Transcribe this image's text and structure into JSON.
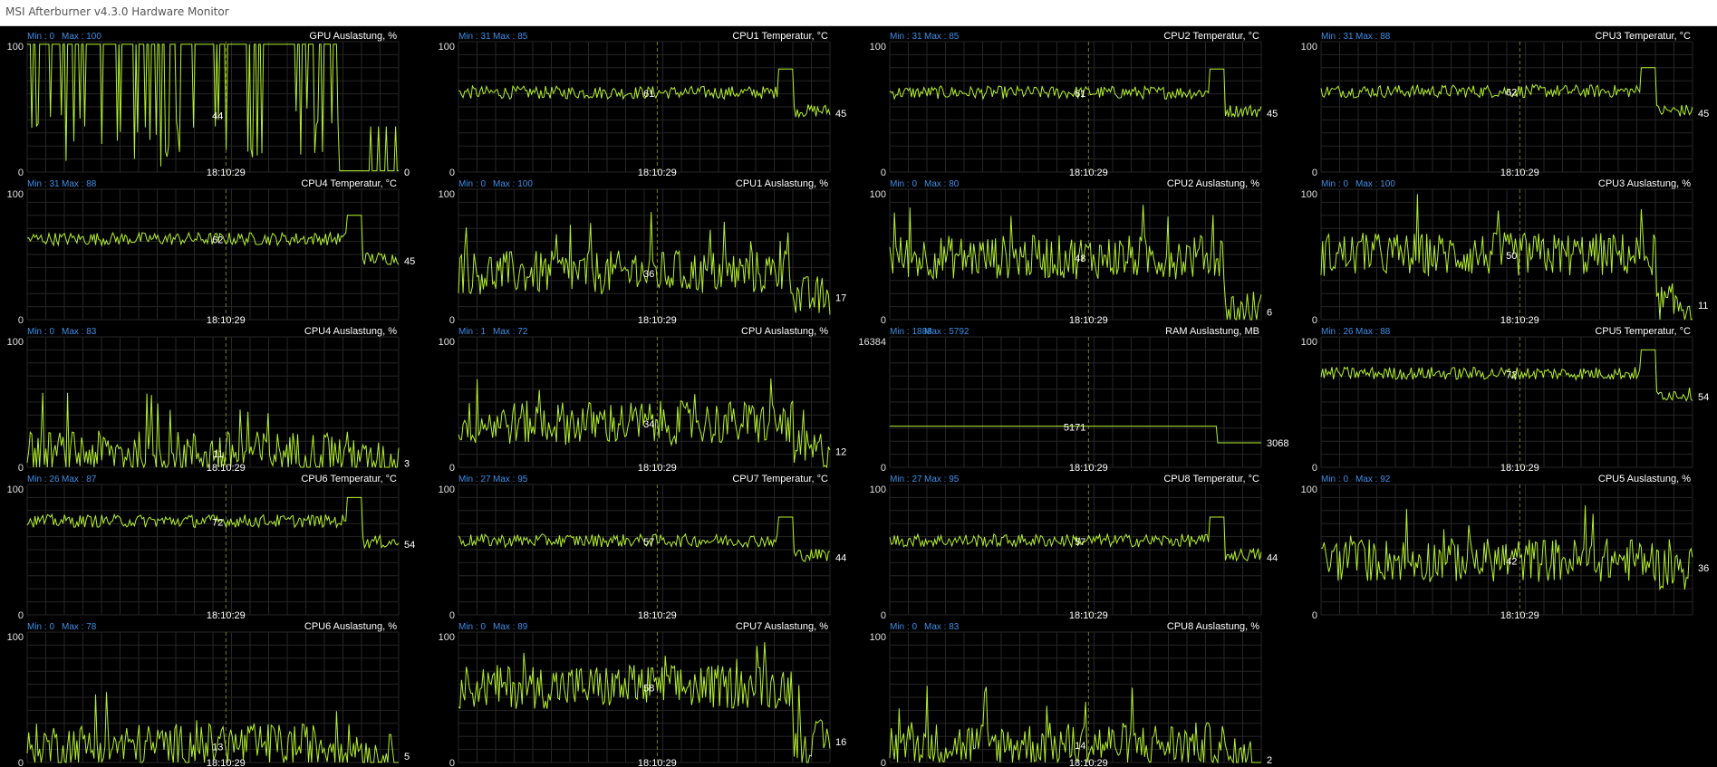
{
  "window": {
    "title": "MSI Afterburner v4.3.0 Hardware Monitor"
  },
  "colors": {
    "background": "#000000",
    "grid": "#262626",
    "trace": "#b5f02e",
    "label_text": "#ffffff",
    "minmax_text": "#3d8ee6",
    "axis_text": "#e0e0e0",
    "cursor": "#7a7a2a"
  },
  "cursor_time": "18:10:29",
  "chart_data": [
    {
      "type": "line",
      "title": "GPU Auslastung, %",
      "min_label": "Min : 0",
      "max_label": "Max : 100",
      "ylim": [
        0,
        100
      ],
      "y_top_label": "100",
      "y_bottom_label": "0",
      "cursor_value": "44",
      "current_value": "0",
      "profile": "gpu"
    },
    {
      "type": "line",
      "title": "CPU1 Temperatur, °C",
      "min_label": "Min : 31",
      "max_label": "Max : 85",
      "ylim": [
        0,
        100
      ],
      "y_top_label": "100",
      "y_bottom_label": "0",
      "cursor_value": "61",
      "current_value": "45",
      "profile": "temp"
    },
    {
      "type": "line",
      "title": "CPU2 Temperatur, °C",
      "min_label": "Min : 31",
      "max_label": "Max : 85",
      "ylim": [
        0,
        100
      ],
      "y_top_label": "100",
      "y_bottom_label": "0",
      "cursor_value": "61",
      "current_value": "45",
      "profile": "temp"
    },
    {
      "type": "line",
      "title": "CPU3 Temperatur, °C",
      "min_label": "Min : 31",
      "max_label": "Max : 88",
      "ylim": [
        0,
        100
      ],
      "y_top_label": "100",
      "y_bottom_label": "0",
      "cursor_value": "62",
      "current_value": "45",
      "profile": "temp"
    },
    {
      "type": "line",
      "title": "CPU4 Temperatur, °C",
      "min_label": "Min : 31",
      "max_label": "Max : 88",
      "ylim": [
        0,
        100
      ],
      "y_top_label": "100",
      "y_bottom_label": "0",
      "cursor_value": "62",
      "current_value": "45",
      "profile": "temp"
    },
    {
      "type": "line",
      "title": "CPU1 Auslastung, %",
      "min_label": "Min : 0",
      "max_label": "Max : 100",
      "ylim": [
        0,
        100
      ],
      "y_top_label": "100",
      "y_bottom_label": "0",
      "cursor_value": "36",
      "current_value": "17",
      "profile": "load"
    },
    {
      "type": "line",
      "title": "CPU2 Auslastung, %",
      "min_label": "Min : 0",
      "max_label": "Max : 80",
      "ylim": [
        0,
        100
      ],
      "y_top_label": "100",
      "y_bottom_label": "0",
      "cursor_value": "48",
      "current_value": "6",
      "profile": "load"
    },
    {
      "type": "line",
      "title": "CPU3 Auslastung, %",
      "min_label": "Min : 0",
      "max_label": "Max : 100",
      "ylim": [
        0,
        100
      ],
      "y_top_label": "100",
      "y_bottom_label": "0",
      "cursor_value": "50",
      "current_value": "11",
      "profile": "load"
    },
    {
      "type": "line",
      "title": "CPU4 Auslastung, %",
      "min_label": "Min : 0",
      "max_label": "Max : 83",
      "ylim": [
        0,
        100
      ],
      "y_top_label": "100",
      "y_bottom_label": "0",
      "cursor_value": "11",
      "current_value": "3",
      "profile": "load"
    },
    {
      "type": "line",
      "title": "CPU Auslastung, %",
      "min_label": "Min : 1",
      "max_label": "Max : 72",
      "ylim": [
        0,
        100
      ],
      "y_top_label": "100",
      "y_bottom_label": "0",
      "cursor_value": "34",
      "current_value": "12",
      "profile": "load"
    },
    {
      "type": "line",
      "title": "RAM Auslastung, MB",
      "min_label": "Min : 1888",
      "max_label": "Max : 5792",
      "ylim": [
        0,
        16384
      ],
      "y_top_label": "16384",
      "y_bottom_label": "0",
      "cursor_value": "5171",
      "current_value": "3068",
      "profile": "ram"
    },
    {
      "type": "line",
      "title": "CPU5 Temperatur, °C",
      "min_label": "Min : 26",
      "max_label": "Max : 88",
      "ylim": [
        0,
        100
      ],
      "y_top_label": "100",
      "y_bottom_label": "0",
      "cursor_value": "72",
      "current_value": "54",
      "profile": "temp"
    },
    {
      "type": "line",
      "title": "CPU6 Temperatur, °C",
      "min_label": "Min : 26",
      "max_label": "Max : 87",
      "ylim": [
        0,
        100
      ],
      "y_top_label": "100",
      "y_bottom_label": "0",
      "cursor_value": "72",
      "current_value": "54",
      "profile": "temp"
    },
    {
      "type": "line",
      "title": "CPU7 Temperatur, °C",
      "min_label": "Min : 27",
      "max_label": "Max : 95",
      "ylim": [
        0,
        100
      ],
      "y_top_label": "100",
      "y_bottom_label": "0",
      "cursor_value": "57",
      "current_value": "44",
      "profile": "temp"
    },
    {
      "type": "line",
      "title": "CPU8 Temperatur, °C",
      "min_label": "Min : 27",
      "max_label": "Max : 95",
      "ylim": [
        0,
        100
      ],
      "y_top_label": "100",
      "y_bottom_label": "0",
      "cursor_value": "57",
      "current_value": "44",
      "profile": "temp"
    },
    {
      "type": "line",
      "title": "CPU5 Auslastung, %",
      "min_label": "Min : 0",
      "max_label": "Max : 92",
      "ylim": [
        0,
        100
      ],
      "y_top_label": "100",
      "y_bottom_label": "0",
      "cursor_value": "42",
      "current_value": "36",
      "profile": "load"
    },
    {
      "type": "line",
      "title": "CPU6 Auslastung, %",
      "min_label": "Min : 0",
      "max_label": "Max : 78",
      "ylim": [
        0,
        100
      ],
      "y_top_label": "100",
      "y_bottom_label": "0",
      "cursor_value": "13",
      "current_value": "5",
      "profile": "load"
    },
    {
      "type": "line",
      "title": "CPU7 Auslastung, %",
      "min_label": "Min : 0",
      "max_label": "Max : 89",
      "ylim": [
        0,
        100
      ],
      "y_top_label": "100",
      "y_bottom_label": "0",
      "cursor_value": "58",
      "current_value": "16",
      "profile": "load"
    },
    {
      "type": "line",
      "title": "CPU8 Auslastung, %",
      "min_label": "Min : 0",
      "max_label": "Max : 83",
      "ylim": [
        0,
        100
      ],
      "y_top_label": "100",
      "y_bottom_label": "0",
      "cursor_value": "14",
      "current_value": "2",
      "profile": "load"
    }
  ]
}
